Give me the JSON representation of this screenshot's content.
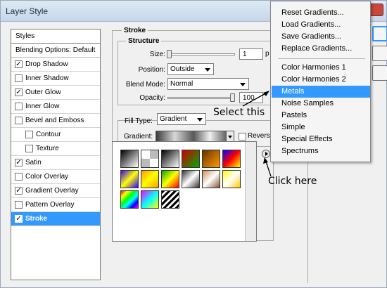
{
  "window": {
    "title": "Layer Style"
  },
  "styles": {
    "header": "Styles",
    "blending_options": "Blending Options: Default",
    "items": [
      {
        "label": "Drop Shadow",
        "checked": true,
        "sub": false,
        "selected": false
      },
      {
        "label": "Inner Shadow",
        "checked": false,
        "sub": false,
        "selected": false
      },
      {
        "label": "Outer Glow",
        "checked": true,
        "sub": false,
        "selected": false
      },
      {
        "label": "Inner Glow",
        "checked": false,
        "sub": false,
        "selected": false
      },
      {
        "label": "Bevel and Emboss",
        "checked": false,
        "sub": false,
        "selected": false
      },
      {
        "label": "Contour",
        "checked": false,
        "sub": true,
        "selected": false
      },
      {
        "label": "Texture",
        "checked": false,
        "sub": true,
        "selected": false
      },
      {
        "label": "Satin",
        "checked": true,
        "sub": false,
        "selected": false
      },
      {
        "label": "Color Overlay",
        "checked": false,
        "sub": false,
        "selected": false
      },
      {
        "label": "Gradient Overlay",
        "checked": true,
        "sub": false,
        "selected": false
      },
      {
        "label": "Pattern Overlay",
        "checked": false,
        "sub": false,
        "selected": false
      },
      {
        "label": "Stroke",
        "checked": true,
        "sub": false,
        "selected": true
      }
    ]
  },
  "stroke": {
    "group_title": "Stroke",
    "structure_title": "Structure",
    "size_label": "Size:",
    "size_value": "1",
    "size_unit": "p",
    "position_label": "Position:",
    "position_value": "Outside",
    "blend_mode_label": "Blend Mode:",
    "blend_mode_value": "Normal",
    "opacity_label": "Opacity:",
    "opacity_value": "100",
    "fill_type_label": "Fill Type:",
    "fill_type_value": "Gradient",
    "gradient_label": "Gradient:",
    "reverse_label": "Reverse"
  },
  "menu": {
    "items": [
      {
        "label": "Reset Gradients...",
        "highlighted": false
      },
      {
        "label": "Load Gradients...",
        "highlighted": false
      },
      {
        "label": "Save Gradients...",
        "highlighted": false
      },
      {
        "label": "Replace Gradients...",
        "highlighted": false
      },
      {
        "label": "Color Harmonies 1",
        "highlighted": false
      },
      {
        "label": "Color Harmonies 2",
        "highlighted": false
      },
      {
        "label": "Metals",
        "highlighted": true
      },
      {
        "label": "Noise Samples",
        "highlighted": false
      },
      {
        "label": "Pastels",
        "highlighted": false
      },
      {
        "label": "Simple",
        "highlighted": false
      },
      {
        "label": "Special Effects",
        "highlighted": false
      },
      {
        "label": "Spectrums",
        "highlighted": false
      }
    ]
  },
  "annotations": {
    "select_this": "Select this",
    "click_here": "Click here"
  },
  "colors": {
    "selection": "#3399ff"
  },
  "gradient_swatches": [
    "linear-gradient(135deg,#000,#fff)",
    "repeating-conic-gradient(#bbb 0 25%,#fff 0 50%)",
    "linear-gradient(135deg,#000,#fff)",
    "linear-gradient(135deg,#c00,#0a0)",
    "linear-gradient(135deg,#630,#f90)",
    "linear-gradient(135deg,#00f,#f00,#ff0)",
    "linear-gradient(135deg,#30f,#ff0,#30f)",
    "linear-gradient(135deg,#f90,#ff0,#f90)",
    "linear-gradient(135deg,#0a0,#ff0,#f00)",
    "linear-gradient(135deg,#333,#fff,#333)",
    "linear-gradient(135deg,#c85,#fff,#853)",
    "linear-gradient(135deg,#ff0,#fff,#fc0)",
    "linear-gradient(135deg,#f00,#ff0,#0f0,#0ff,#00f,#f0f)",
    "linear-gradient(135deg,#f0f,#0ff,#ff0)",
    "repeating-linear-gradient(135deg,#000 0 3px,#fff 3px 6px)"
  ]
}
